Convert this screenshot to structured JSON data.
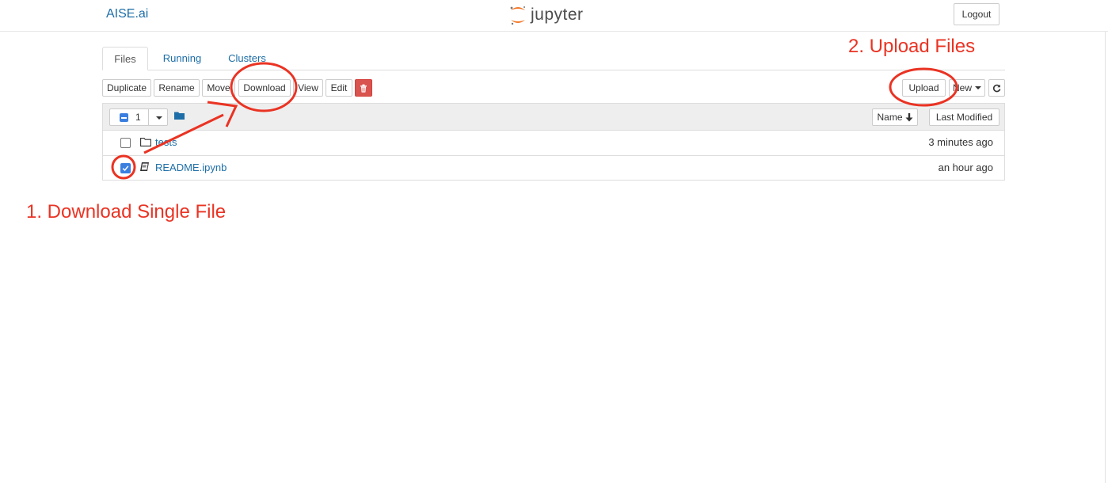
{
  "header": {
    "brand": "AISE.ai",
    "logo_text": "jupyter",
    "logout_label": "Logout"
  },
  "tabs": [
    {
      "label": "Files",
      "active": true
    },
    {
      "label": "Running",
      "active": false
    },
    {
      "label": "Clusters",
      "active": false
    }
  ],
  "toolbar": {
    "duplicate": "Duplicate",
    "rename": "Rename",
    "move": "Move",
    "download": "Download",
    "view": "View",
    "edit": "Edit",
    "delete_icon": "trash-icon",
    "upload": "Upload",
    "new": "New",
    "refresh_icon": "refresh-icon"
  },
  "list_header": {
    "selected_count": "1",
    "sort_name": "Name",
    "sort_modified": "Last Modified"
  },
  "files": [
    {
      "name": "tests",
      "type": "folder",
      "checked": false,
      "modified": "3 minutes ago"
    },
    {
      "name": "README.ipynb",
      "type": "notebook",
      "checked": true,
      "modified": "an hour ago"
    }
  ],
  "annotations": {
    "download": "1. Download Single File",
    "upload": "2. Upload Files",
    "color": "#ea3323"
  },
  "colors": {
    "link": "#1d6ea8",
    "accent_orange": "#f37726",
    "danger": "#d9534f",
    "checkbox": "#3a7fe0"
  }
}
